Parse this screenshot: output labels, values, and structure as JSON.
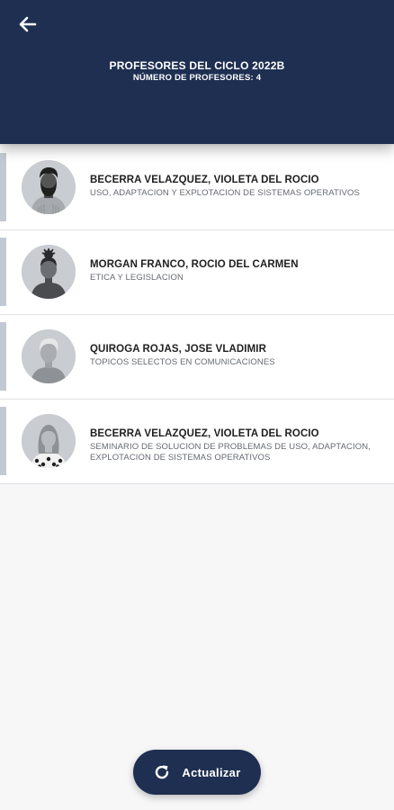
{
  "header": {
    "title": "PROFESORES DEL CICLO 2022B",
    "subtitle": "NÚMERO DE PROFESORES: 4",
    "back_icon": "arrow-left-icon"
  },
  "professors": [
    {
      "name": "BECERRA VELAZQUEZ, VIOLETA DEL ROCIO",
      "subject": "USO, ADAPTACION Y EXPLOTACION DE SISTEMAS OPERATIVOS",
      "avatar": "man-beard-avatar"
    },
    {
      "name": "MORGAN FRANCO, ROCIO DEL CARMEN",
      "subject": "ETICA Y LEGISLACION",
      "avatar": "woman-bun-avatar"
    },
    {
      "name": "QUIROGA ROJAS, JOSE VLADIMIR",
      "subject": "TOPICOS SELECTOS EN COMUNICACIONES",
      "avatar": "older-man-avatar"
    },
    {
      "name": "BECERRA VELAZQUEZ, VIOLETA DEL ROCIO",
      "subject": "SEMINARIO DE SOLUCION DE PROBLEMAS DE USO, ADAPTACION, EXPLOTACION DE SISTEMAS OPERATIVOS",
      "avatar": "woman-polka-dot-avatar"
    }
  ],
  "fab": {
    "label": "Actualizar",
    "icon": "refresh-icon"
  },
  "colors": {
    "primary": "#1e2f51",
    "accent_bar": "#c3c9d3",
    "background": "#f7f7f8"
  }
}
